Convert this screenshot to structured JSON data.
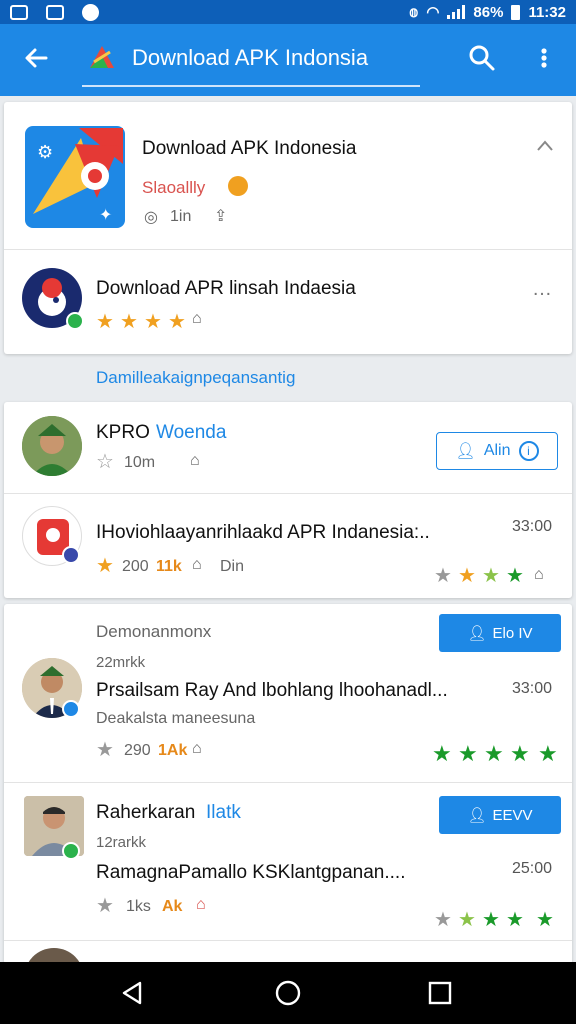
{
  "status_bar": {
    "battery": "86%",
    "time": "11:32"
  },
  "app_bar": {
    "title": "Download APK Indonsia"
  },
  "featured": {
    "title": "Download APK Indonesia",
    "tagline": "Slaoallly",
    "meta": "1in"
  },
  "second": {
    "title": "Download APR linsah Indaesia"
  },
  "section_label": "Damilleakaignpeqansantig",
  "list1": [
    {
      "name": "KPRO",
      "name_accent": "Woenda",
      "stat": "10m",
      "action": "Alin"
    },
    {
      "title": "IHoviohlaayanrihlaakd APR Indanesia:..",
      "time": "33:00",
      "stat": "200",
      "stat_accent": "11k",
      "extra": "Din"
    }
  ],
  "list2": [
    {
      "header": "Demonanmonx",
      "sub": "22mrkk",
      "title": "Prsailsam Ray And lbohlang lhoohanadl...",
      "time": "33:00",
      "desc": "Deakalsta maneesuna",
      "stat": "290",
      "stat_accent": "1Ak",
      "action": "Elo IV"
    },
    {
      "name": "Raherkaran",
      "name_accent": "Ilatk",
      "sub": "12rarkk",
      "title": "RamagnaPamallo KSKlantgpanan....",
      "time": "25:00",
      "stat": "1ks",
      "stat_accent": "Ak",
      "action": "EEVV"
    }
  ],
  "colors": {
    "primary": "#1e88e5",
    "status": "#0d5fb8",
    "star_orange": "#f0a020",
    "star_green": "#1a9a2a",
    "badge_green": "#2bb24c"
  }
}
